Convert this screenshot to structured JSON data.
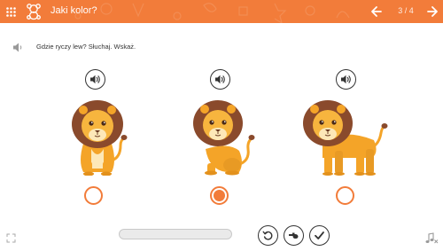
{
  "header": {
    "title": "Jaki kolor?",
    "counter": "3 / 4",
    "background": "#f27c3a",
    "icons": {
      "menu": "grid-icon",
      "mascot": "teddy-bear-icon",
      "prev": "arrow-left-icon",
      "next": "arrow-right-icon"
    }
  },
  "instruction": {
    "text": "Gdzie ryczy lew? Słuchaj. Wskaż.",
    "icon": "speaker-icon"
  },
  "options": [
    {
      "name": "lion-1",
      "selected": false,
      "icon": "speaker-icon"
    },
    {
      "name": "lion-2",
      "selected": true,
      "icon": "speaker-icon"
    },
    {
      "name": "lion-3",
      "selected": false,
      "icon": "speaker-icon"
    }
  ],
  "footer": {
    "progress": 0,
    "controls": [
      "replay-icon",
      "whistle-icon",
      "check-icon"
    ],
    "icons": {
      "fullscreen": "expand-icon",
      "music": "music-off-icon"
    }
  },
  "colors": {
    "accent": "#f27c3a",
    "mane": "#8a4a2c",
    "lion_body": "#f4a428",
    "lion_face": "#f7b53e",
    "muzzle": "#fde8b8"
  }
}
